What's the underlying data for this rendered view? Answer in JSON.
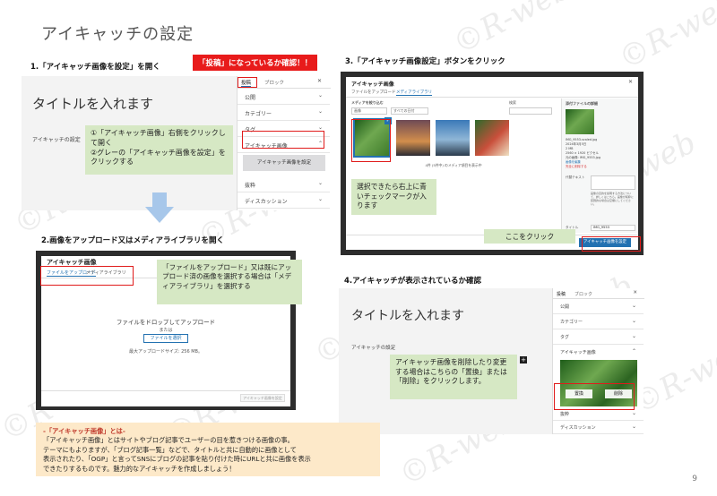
{
  "page": {
    "title": "アイキャッチの設定",
    "page_number": "9",
    "watermark": "©R-web"
  },
  "step1": {
    "heading": "1.「アイキャッチ画像を設定」を開く",
    "badge": "「投稿」になっているか確認！！",
    "editor_title": "タイトルを入れます",
    "eyecatch_label": "アイキャッチの設定",
    "sidebar_tabs": [
      "投稿",
      "ブロック"
    ],
    "sidebar_rows": [
      "公開",
      "カテゴリー",
      "タグ",
      "アイキャッチ画像",
      "抜粋",
      "ディスカッション"
    ],
    "set_button": "アイキャッチ画像を設定",
    "note": "①「アイキャッチ画像」右側をクリックして開く\n②グレーの「アイキャッチ画像を設定」をクリックする"
  },
  "step2": {
    "heading": "2.画像をアップロード又はメディアライブラリを開く",
    "modal_title": "アイキャッチ画像",
    "tabs": [
      "ファイルをアップロード",
      "メディアライブラリ"
    ],
    "drop_text": "ファイルをドロップしてアップロード",
    "or_text": "または",
    "select_button": "ファイルを選択",
    "max_size": "最大アップロードサイズ: 256 MB。",
    "footer_button": "アイキャッチ画像を設定",
    "note": "「ファイルをアップロード」又は既にアップロード済の画像を選択する場合は「メディアライブラリ」を選択する"
  },
  "step3": {
    "heading": "3.「アイキャッチ画像設定」ボタンをクリック",
    "modal_title": "アイキャッチ画像",
    "tabs": [
      "ファイルをアップロード",
      "メディアライブラリ"
    ],
    "filter_label": "メディアを絞り込む",
    "filter_type": "画像",
    "filter_date": "すべての日付",
    "search_label": "検索",
    "count_text": "4件 (5件中) のメディア項目を表示中",
    "details_heading": "添付ファイルの詳細",
    "details_lines": [
      "IMG_9553-scaled.jpg",
      "2024年3月5日",
      "2 MB",
      "2560 × 1920 ピクセル",
      "元の画像: IMG_9553.jpg",
      "画像を編集",
      "完全に削除する"
    ],
    "alt_label": "代替テキスト",
    "alt_help": "画像の目的を説明する方法について、詳しくはこちら。画像が純粋に装飾的な場合は空欄にしてください。",
    "title_label": "タイトル",
    "title_value": "IMG_9553",
    "set_button": "アイキャッチ画像を設定",
    "note1": "選択できたら右上に青いチェックマークが入ります",
    "note2": "ここをクリック"
  },
  "step4": {
    "heading": "4.アイキャッチが表示されているか確認",
    "editor_title": "タイトルを入れます",
    "eyecatch_label": "アイキャッチの設定",
    "sidebar_tabs": [
      "投稿",
      "ブロック"
    ],
    "sidebar_rows": [
      "公開",
      "カテゴリー",
      "タグ",
      "アイキャッチ画像",
      "抜粋",
      "ディスカッション"
    ],
    "replace_button": "置換",
    "delete_button": "削除",
    "note": "アイキャッチ画像を削除したり変更する場合はこちらの「置換」または「削除」をクリックします。"
  },
  "definition": {
    "title": "-「アイキャッチ画像」とは-",
    "lines": [
      "「アイキャッチ画像」とはサイトやブログ記事でユーザーの目を惹きつける画像の事。",
      "テーマにもよりますが、「ブログ記事一覧」などで、タイトルと共に自動的に画像として",
      "表示されたり、「OGP」と言ってSNSにブログの記事を貼り付けた時にURLと共に画像を表示",
      "できたりするものです。魅力的なアイキャッチを作成しましょう！"
    ]
  },
  "colors": {
    "accent_blue": "#2271b1",
    "red": "#e01b1b",
    "note_green": "#d6e8c4",
    "definition_bg": "#fde9c9",
    "arrow_blue": "#a7c7ea"
  }
}
